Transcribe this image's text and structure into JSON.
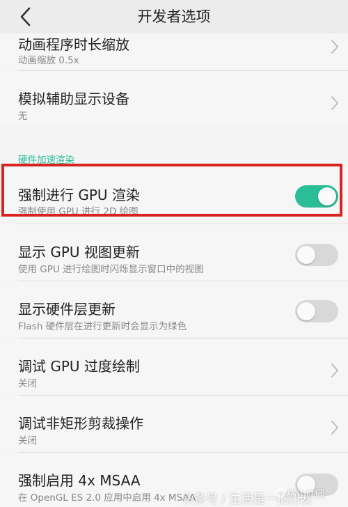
{
  "header": {
    "title": "开发者选项",
    "back_icon": "chevron-left-icon"
  },
  "rows": {
    "animation_scale": {
      "title": "动画程序时长缩放",
      "subtitle": "动画缩放 0.5x"
    },
    "simulate_display": {
      "title": "模拟辅助显示设备",
      "subtitle": "无"
    },
    "section_hw": "硬件加速渲染",
    "force_gpu": {
      "title": "强制进行 GPU 渲染",
      "subtitle": "强制使用 GPU 进行 2D 绘图",
      "enabled": true
    },
    "show_gpu_updates": {
      "title": "显示 GPU 视图更新",
      "subtitle": "使用 GPU 进行绘图时闪烁显示窗口中的视图",
      "enabled": false
    },
    "show_hw_layers": {
      "title": "显示硬件层更新",
      "subtitle": "Flash 硬件层在进行更新时会显示为绿色",
      "enabled": false
    },
    "debug_overdraw": {
      "title": "调试 GPU 过度绘制",
      "subtitle": "关闭"
    },
    "debug_nonrect": {
      "title": "调试非矩形剪裁操作",
      "subtitle": "关闭"
    },
    "force_msaa": {
      "title": "强制启用 4x MSAA",
      "subtitle": "在 OpenGL ES 2.0 应用中启用 4x MSAA"
    }
  },
  "watermark": {
    "text": "头条号 / 生活是一把刀发",
    "site": "横山IT网"
  },
  "colors": {
    "accent": "#2bbd98",
    "highlight": "#d9231f"
  }
}
